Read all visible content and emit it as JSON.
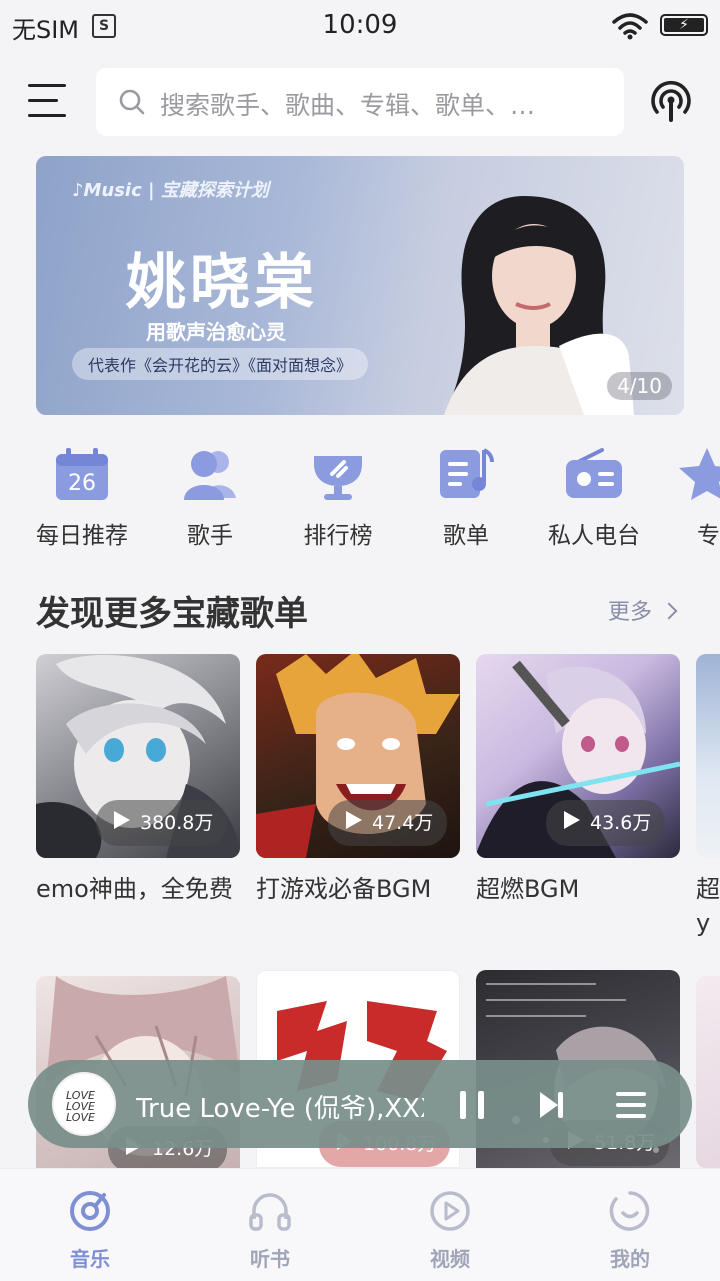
{
  "status_bar": {
    "carrier": "无SIM",
    "sim_badge": "S",
    "time": "10:09"
  },
  "search": {
    "placeholder": "搜索歌手、歌曲、专辑、歌单、…"
  },
  "banner": {
    "brand": "♪Music | 宝藏探索计划",
    "artist": "姚晓棠",
    "slogan": "用歌声治愈心灵",
    "works": "代表作《会开花的云》《面对面想念》",
    "page": "4/10"
  },
  "shortcuts": [
    {
      "label": "每日推荐",
      "icon": "calendar-icon",
      "badge": "26"
    },
    {
      "label": "歌手",
      "icon": "singer-icon"
    },
    {
      "label": "排行榜",
      "icon": "trophy-icon"
    },
    {
      "label": "歌单",
      "icon": "playlist-icon"
    },
    {
      "label": "私人电台",
      "icon": "radio-icon"
    },
    {
      "label": "专",
      "icon": "star-icon"
    }
  ],
  "section": {
    "title": "发现更多宝藏歌单",
    "more": "更多"
  },
  "playlists": [
    {
      "title": "emo神曲，全免费",
      "plays": "380.8万"
    },
    {
      "title": "打游戏必备BGM",
      "plays": "47.4万"
    },
    {
      "title": "超燃BGM",
      "plays": "43.6万"
    },
    {
      "title": "超yy"
    },
    {
      "plays": "12.6万"
    },
    {
      "plays": "100.8万"
    },
    {
      "plays": "51.8万"
    }
  ],
  "player": {
    "song": "True Love-Ye (侃爷),XXXTENTACION",
    "disc_text": "LOVE LOVE LOVE"
  },
  "bottom_nav": [
    {
      "label": "音乐",
      "icon": "music-disc-icon",
      "active": true
    },
    {
      "label": "听书",
      "icon": "headphones-icon"
    },
    {
      "label": "视频",
      "icon": "video-play-icon"
    },
    {
      "label": "我的",
      "icon": "profile-icon"
    }
  ],
  "colors": {
    "accent": "#7f8fd4",
    "icon_blue": "#8b9be0",
    "inactive": "#b8bccc",
    "player_bg": "#7a8f8b"
  }
}
